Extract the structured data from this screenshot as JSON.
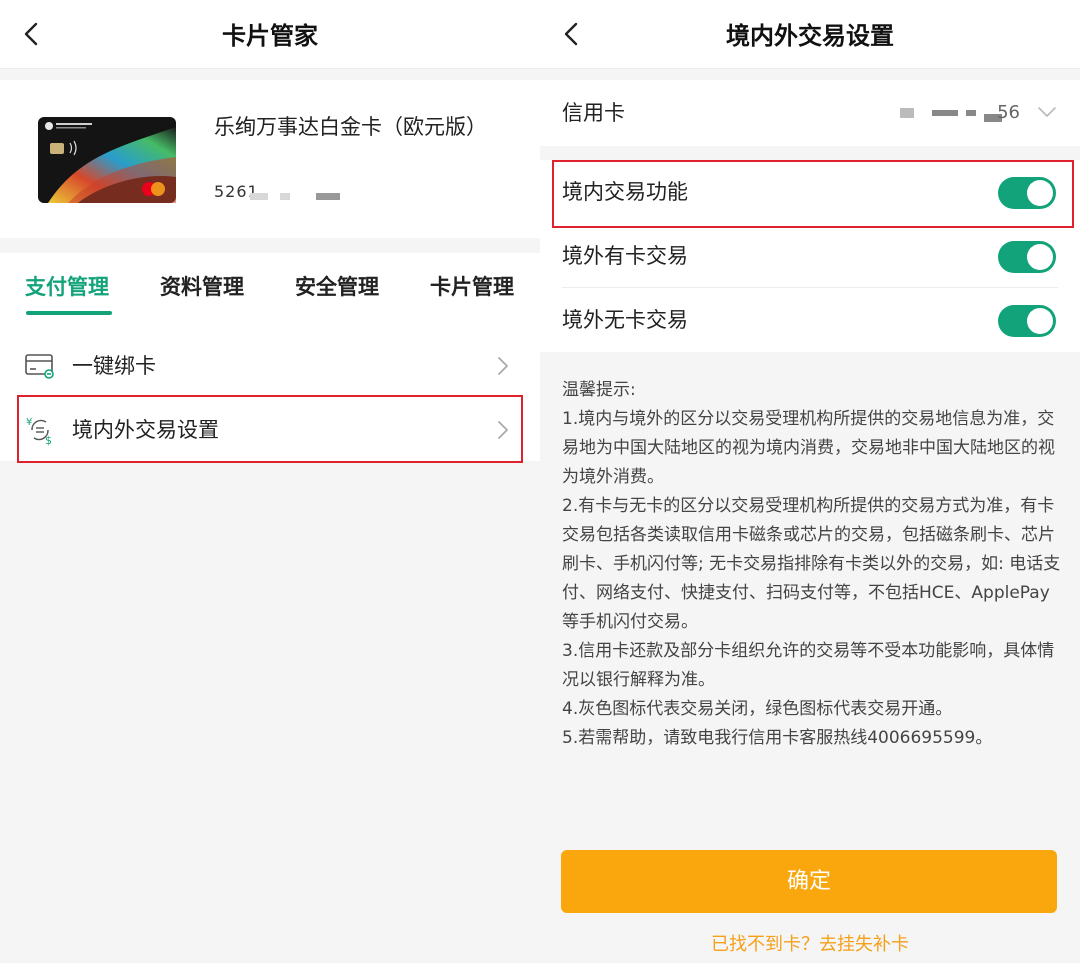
{
  "left": {
    "title": "卡片管家",
    "card": {
      "name": "乐绚万事达白金卡（欧元版）",
      "number_prefix": "5261"
    },
    "tabs": [
      "支付管理",
      "资料管理",
      "安全管理",
      "卡片管理"
    ],
    "active_tab": 0,
    "items": [
      {
        "label": "一键绑卡",
        "icon": "card-link-icon"
      },
      {
        "label": "境内外交易设置",
        "icon": "currency-exchange-icon"
      }
    ]
  },
  "right": {
    "title": "境内外交易设置",
    "card_select": {
      "label": "信用卡",
      "value_suffix": "56"
    },
    "toggles": [
      {
        "label": "境内交易功能",
        "on": true
      },
      {
        "label": "境外有卡交易",
        "on": true
      },
      {
        "label": "境外无卡交易",
        "on": true
      }
    ],
    "tips": {
      "heading": "温馨提示:",
      "lines": [
        "1.境内与境外的区分以交易受理机构所提供的交易地信息为准，交易地为中国大陆地区的视为境内消费，交易地非中国大陆地区的视为境外消费。",
        "2.有卡与无卡的区分以交易受理机构所提供的交易方式为准，有卡交易包括各类读取信用卡磁条或芯片的交易，包括磁条刷卡、芯片刷卡、手机闪付等; 无卡交易指排除有卡类以外的交易，如: 电话支付、网络支付、快捷支付、扫码支付等，不包括HCE、ApplePay等手机闪付交易。",
        "3.信用卡还款及部分卡组织允许的交易等不受本功能影响，具体情况以银行解释为准。",
        "4.灰色图标代表交易关闭，绿色图标代表交易开通。",
        "5.若需帮助，请致电我行信用卡客服热线4006695599。"
      ]
    },
    "confirm_label": "确定",
    "lost_card_link": "已找不到卡？去挂失补卡"
  },
  "colors": {
    "accent": "#13a37a",
    "button": "#f9a70c",
    "link": "#f5a01a",
    "highlight": "#e0222e"
  }
}
